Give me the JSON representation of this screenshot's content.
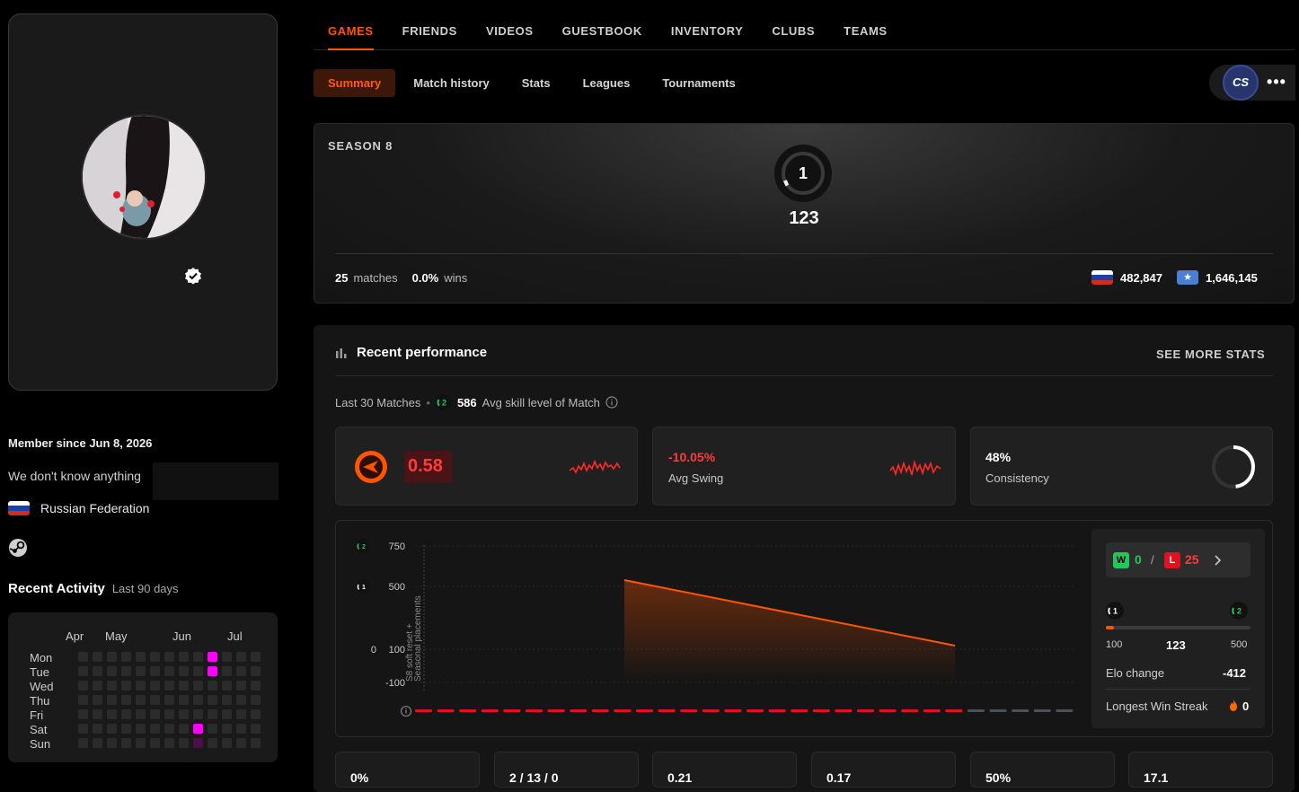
{
  "profile": {
    "member_since": "Member since Jun 8, 2026",
    "bio": "We don't know anything",
    "country": "Russian Federation"
  },
  "activity": {
    "title": "Recent Activity",
    "subtitle": "Last 90 days",
    "months": [
      "Apr",
      "May",
      "Jun",
      "Jul"
    ],
    "days": [
      "Mon",
      "Tue",
      "Wed",
      "Thu",
      "Fri",
      "Sat",
      "Sun"
    ],
    "highlight_color": "#ff00ff"
  },
  "top_nav": [
    "GAMES",
    "FRIENDS",
    "VIDEOS",
    "GUESTBOOK",
    "INVENTORY",
    "CLUBS",
    "TEAMS"
  ],
  "sub_nav": [
    "Summary",
    "Match history",
    "Stats",
    "Leagues",
    "Tournaments"
  ],
  "game_logo": "CS",
  "season": {
    "title": "SEASON 8",
    "level": "1",
    "elo": "123",
    "matches": "25",
    "matches_label": "matches",
    "win_rate": "0.0%",
    "wins_label": "wins",
    "country_rank": "482,847",
    "region_rank": "1,646,145"
  },
  "performance": {
    "title": "Recent performance",
    "see_more": "SEE MORE STATS",
    "last_matches": "Last 30 Matches",
    "avg_skill_level_badge": "2",
    "avg_skill": "586",
    "avg_skill_label": "Avg skill level of Match",
    "kpis": {
      "rating": "0.58",
      "swing_value": "-10.05%",
      "swing_label": "Avg Swing",
      "consistency_value": "48%",
      "consistency_label": "Consistency"
    }
  },
  "chart_data": {
    "type": "area",
    "y_tick_labels": [
      "750",
      "500",
      "0",
      "100",
      "-100"
    ],
    "annotation_line1": "S8 soft reset +",
    "annotation_line2": "Seasonal placements",
    "x": [
      1,
      30
    ],
    "y": [
      540,
      123
    ],
    "results": [
      "L",
      "L",
      "L",
      "L",
      "L",
      "L",
      "L",
      "L",
      "L",
      "L",
      "L",
      "L",
      "L",
      "L",
      "L",
      "L",
      "L",
      "L",
      "L",
      "L",
      "L",
      "L",
      "L",
      "L",
      "L",
      "",
      "",
      "",
      "",
      ""
    ],
    "colors": {
      "line": "#ff5500",
      "loss": "#e3111f",
      "empty": "#4a5058"
    }
  },
  "side": {
    "wins": "0",
    "losses": "25",
    "w_letter": "W",
    "l_letter": "L",
    "separator": "/",
    "level_from": "1",
    "level_to": "2",
    "range_min": "100",
    "current": "123",
    "range_max": "500",
    "elo_change_label": "Elo change",
    "elo_change": "-412",
    "streak_label": "Longest Win Streak",
    "streak": "0"
  },
  "bottom_stats": [
    "0%",
    "2 / 13 / 0",
    "0.21",
    "0.17",
    "50%",
    "17.1"
  ]
}
